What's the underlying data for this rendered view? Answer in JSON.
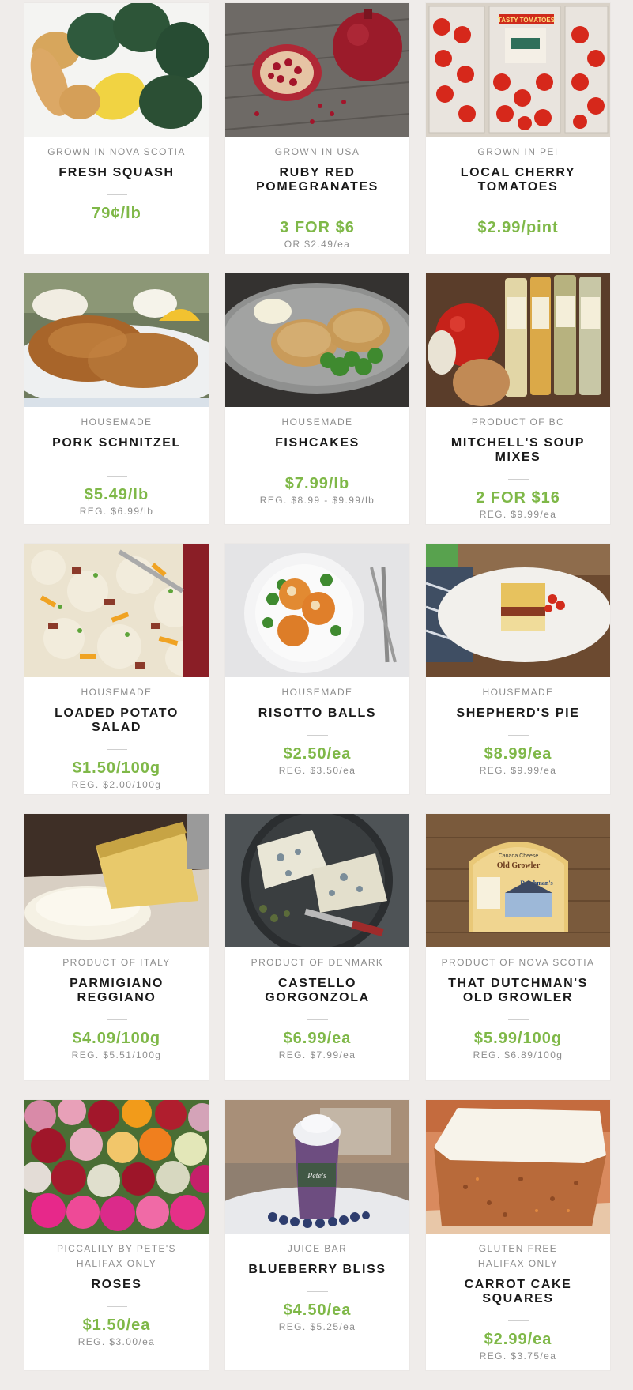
{
  "colors": {
    "background": "#efecea",
    "card": "#ffffff",
    "price": "#7fb848",
    "muted": "#8d8d8d",
    "name": "#1a1a1a"
  },
  "products": [
    {
      "origin": "GROWN IN NOVA SCOTIA",
      "name": "FRESH SQUASH",
      "price": "79¢/lb",
      "reg": "",
      "image": "squash-photo"
    },
    {
      "origin": "GROWN IN USA",
      "name": "RUBY RED POMEGRANATES",
      "price": "3 FOR $6",
      "reg": "OR $2.49/ea",
      "image": "pomegranate-photo"
    },
    {
      "origin": "GROWN IN PEI",
      "name": "LOCAL CHERRY TOMATOES",
      "price": "$2.99/pint",
      "reg": "",
      "image": "cherry-tomatoes-photo"
    },
    {
      "origin": "HOUSEMADE",
      "name": "PORK SCHNITZEL",
      "price": "$5.49/lb",
      "reg": "REG. $6.99/lb",
      "image": "schnitzel-photo"
    },
    {
      "origin": "HOUSEMADE",
      "name": "FISHCAKES",
      "price": "$7.99/lb",
      "reg": "REG. $8.99 - $9.99/lb",
      "image": "fishcakes-photo"
    },
    {
      "origin": "PRODUCT OF BC",
      "name": "MITCHELL'S SOUP MIXES",
      "price": "2 FOR $16",
      "reg": "REG. $9.99/ea",
      "image": "soup-mixes-photo"
    },
    {
      "origin": "HOUSEMADE",
      "name": "LOADED POTATO SALAD",
      "price": "$1.50/100g",
      "reg": "REG. $2.00/100g",
      "image": "potato-salad-photo"
    },
    {
      "origin": "HOUSEMADE",
      "name": "RISOTTO BALLS",
      "price": "$2.50/ea",
      "reg": "REG. $3.50/ea",
      "image": "risotto-balls-photo"
    },
    {
      "origin": "HOUSEMADE",
      "name": "SHEPHERD'S PIE",
      "price": "$8.99/ea",
      "reg": "REG. $9.99/ea",
      "image": "shepherds-pie-photo"
    },
    {
      "origin": "PRODUCT OF ITALY",
      "name": "PARMIGIANO REGGIANO",
      "price": "$4.09/100g",
      "reg": "REG. $5.51/100g",
      "image": "parmigiano-photo"
    },
    {
      "origin": "PRODUCT OF DENMARK",
      "name": "CASTELLO GORGONZOLA",
      "price": "$6.99/ea",
      "reg": "REG. $7.99/ea",
      "image": "gorgonzola-photo"
    },
    {
      "origin": "PRODUCT OF NOVA SCOTIA",
      "name": "THAT DUTCHMAN'S OLD GROWLER",
      "price": "$5.99/100g",
      "reg": "REG. $6.89/100g",
      "image": "old-growler-photo"
    },
    {
      "origin": "PICCALILY BY PETE'S HALIFAX ONLY",
      "name": "ROSES",
      "price": "$1.50/ea",
      "reg": "REG. $3.00/ea",
      "image": "roses-photo"
    },
    {
      "origin": "JUICE BAR",
      "name": "BLUEBERRY BLISS",
      "price": "$4.50/ea",
      "reg": "REG. $5.25/ea",
      "image": "smoothie-photo"
    },
    {
      "origin": "GLUTEN FREE HALIFAX ONLY",
      "name": "CARROT CAKE SQUARES",
      "price": "$2.99/ea",
      "reg": "REG. $3.75/ea",
      "image": "carrot-cake-photo"
    }
  ],
  "photo_text": {
    "tomato_label": "TASTY TOMATOES",
    "growler_label_1": "Canada Cheese",
    "growler_label_2": "Old Growler",
    "growler_label_3": "Dutchman's",
    "smoothie_label": "Pete's"
  }
}
